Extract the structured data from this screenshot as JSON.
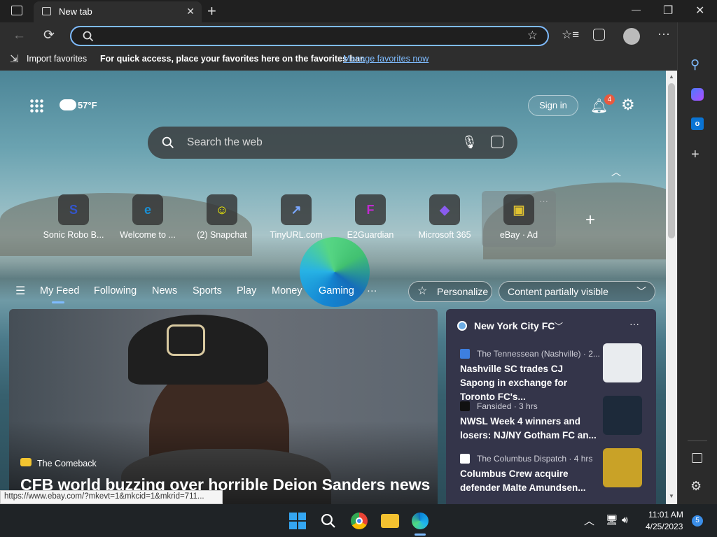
{
  "window": {
    "tab_title": "New tab",
    "new_tab": "+",
    "minimize": "—",
    "restore": "❐",
    "close": "✕"
  },
  "toolbar": {
    "address_value": "",
    "address_placeholder": ""
  },
  "favorites_bar": {
    "import_label": "Import favorites",
    "hint": "For quick access, place your favorites here on the favorites bar.",
    "manage_link": "Manage favorites now"
  },
  "newtab": {
    "weather": "57°F",
    "signin": "Sign in",
    "notifications_count": "4",
    "search_placeholder": "Search the web",
    "tiles": [
      {
        "label": "Sonic Robo B...",
        "glyph": "S",
        "color": "#3355cc"
      },
      {
        "label": "Welcome to ...",
        "glyph": "e",
        "color": "#1a8fd4"
      },
      {
        "label": "(2) Snapchat",
        "glyph": "☺",
        "color": "#fffc00"
      },
      {
        "label": "TinyURL.com",
        "glyph": "↗",
        "color": "#7aa7ff"
      },
      {
        "label": "E2Guardian",
        "glyph": "F",
        "color": "#c12ad1"
      },
      {
        "label": "Microsoft 365",
        "glyph": "◆",
        "color": "#8a5cf0"
      },
      {
        "label": "eBay · Ad",
        "glyph": "▣",
        "color": "#e0c231"
      }
    ]
  },
  "feed": {
    "menu": "☰",
    "tabs": [
      "My Feed",
      "Following",
      "News",
      "Sports",
      "Play",
      "Money",
      "Gaming"
    ],
    "more": "···",
    "personalize": "Personalize",
    "visibility": "Content partially visible"
  },
  "hero": {
    "source": "The Comeback",
    "headline": "CFB world buzzing over horrible Deion Sanders news"
  },
  "news_card": {
    "title": "New York City FC",
    "items": [
      {
        "source": "The Tennessean (Nashville) · 2...",
        "headline": "Nashville SC trades CJ Sapong in exchange for Toronto FC's..."
      },
      {
        "source": "Fansided · 3 hrs",
        "headline": "NWSL Week 4 winners and losers: NJ/NY Gotham FC an..."
      },
      {
        "source": "The Columbus Dispatch · 4 hrs",
        "headline": "Columbus Crew acquire defender Malte Amundsen..."
      }
    ]
  },
  "status_url": "https://www.ebay.com/?mkevt=1&mkcid=1&mkrid=711...",
  "taskbar": {
    "time": "11:01 AM",
    "date": "4/25/2023",
    "badge": "5"
  }
}
